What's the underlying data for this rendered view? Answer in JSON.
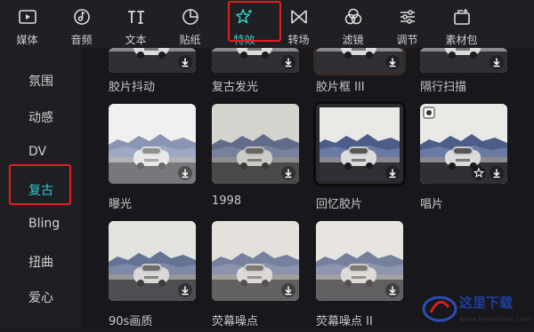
{
  "toolbar": {
    "items": [
      {
        "label": "媒体",
        "icon": "play-icon"
      },
      {
        "label": "音频",
        "icon": "music-icon"
      },
      {
        "label": "文本",
        "icon": "text-icon"
      },
      {
        "label": "贴纸",
        "icon": "sticker-icon"
      },
      {
        "label": "特效",
        "icon": "sparkle-star-icon"
      },
      {
        "label": "转场",
        "icon": "transition-icon"
      },
      {
        "label": "滤镜",
        "icon": "filter-icon"
      },
      {
        "label": "调节",
        "icon": "sliders-icon"
      },
      {
        "label": "素材包",
        "icon": "material-pack-icon"
      }
    ],
    "active": "特效",
    "accent": "#32d1c6",
    "highlight": "#e02020"
  },
  "sidebar": {
    "items": [
      "氛围",
      "动感",
      "DV",
      "复古",
      "Bling",
      "扭曲",
      "爱心"
    ],
    "active": "复古",
    "active_color": "#2fc7d4"
  },
  "grid": {
    "row0": [
      "胶片抖动",
      "复古发光",
      "胶片框 III",
      "隔行扫描"
    ],
    "row1": [
      "曝光",
      "1998",
      "回忆胶片",
      "唱片"
    ],
    "row2": [
      "90s画质",
      "荧幕噪点",
      "荧幕噪点 II",
      ""
    ]
  },
  "watermark": {
    "text": "这里下载",
    "url": "www.heredown.com"
  }
}
